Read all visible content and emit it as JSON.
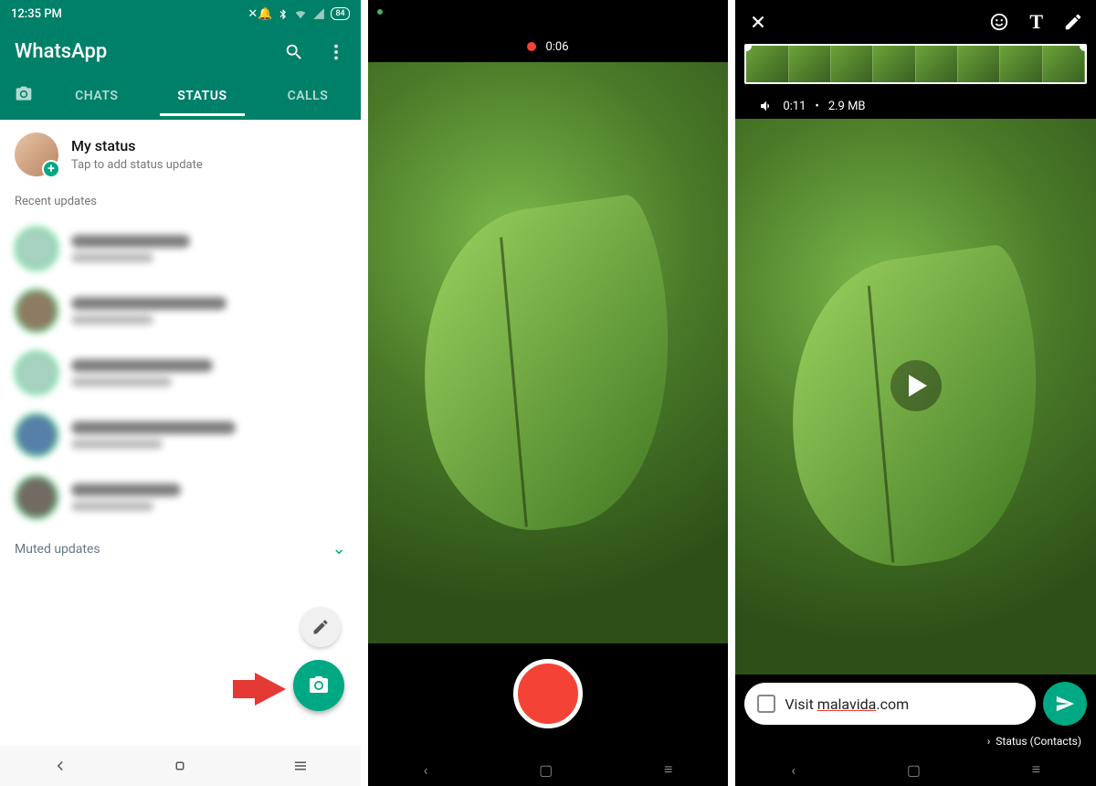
{
  "colors": {
    "primary": "#008069",
    "accent": "#00a884",
    "record": "#f44336",
    "arrow": "#e53935"
  },
  "screen1": {
    "statusbar": {
      "time": "12:35 PM",
      "battery": "84"
    },
    "app_title": "WhatsApp",
    "tabs": {
      "chats": "CHATS",
      "status": "STATUS",
      "calls": "CALLS"
    },
    "my_status": {
      "title": "My status",
      "subtitle": "Tap to add status update"
    },
    "section_recent": "Recent updates",
    "muted_label": "Muted updates"
  },
  "screen2": {
    "recording_time": "0:06"
  },
  "screen3": {
    "video_duration": "0:11",
    "video_size": "2.9 MB",
    "caption_prefix": "Visit ",
    "caption_link": "malavida",
    "caption_suffix": ".com",
    "recipients_label": "Status (Contacts)"
  }
}
